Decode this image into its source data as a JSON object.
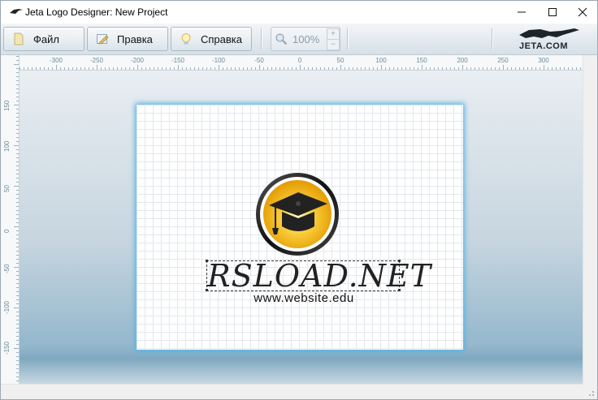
{
  "window": {
    "title": "Jeta Logo Designer: New Project"
  },
  "toolbar": {
    "buttons": [
      {
        "label": "Файл",
        "icon": "file-icon"
      },
      {
        "label": "Правка",
        "icon": "edit-icon"
      },
      {
        "label": "Справка",
        "icon": "help-bulb-icon"
      }
    ],
    "zoom": {
      "value": "100%",
      "plus": "+",
      "minus": "−"
    },
    "brand_logo": "JETA.COM"
  },
  "rulers": {
    "horizontal_labels": [
      "-300",
      "-250",
      "-200",
      "-150",
      "-100",
      "-50",
      "0",
      "50",
      "100",
      "150",
      "200",
      "250",
      "300"
    ],
    "vertical_labels": [
      "150",
      "100",
      "50",
      "0",
      "-50",
      "-100",
      "-150"
    ]
  },
  "design": {
    "emblem_icon": "graduation-cap-icon",
    "brand_text": "RSLOAD.NET",
    "website_text": "www.website.edu",
    "colors": {
      "emblem_gold": "#f5b81e",
      "page_glow": "#5ab4e4"
    }
  }
}
